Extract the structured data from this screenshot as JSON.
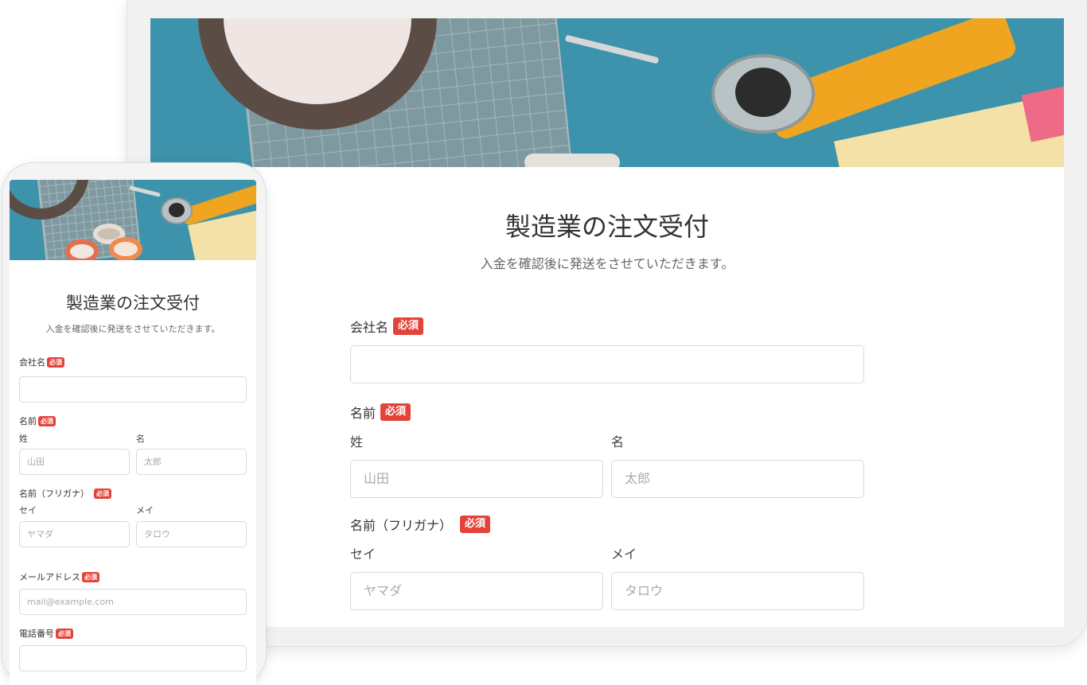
{
  "form": {
    "title": "製造業の注文受付",
    "subtitle": "入金を確認後に発送をさせていただきます。",
    "required_badge": "必須",
    "company": {
      "label": "会社名",
      "value": ""
    },
    "name": {
      "label": "名前",
      "last_label": "姓",
      "last_placeholder": "山田",
      "first_label": "名",
      "first_placeholder": "太郎"
    },
    "kana": {
      "label": "名前（フリガナ）",
      "last_label": "セイ",
      "last_placeholder": "ヤマダ",
      "first_label": "メイ",
      "first_placeholder": "タロウ"
    },
    "email": {
      "label": "メールアドレス",
      "placeholder": "mail@example.com"
    },
    "phone": {
      "label": "電話番号"
    }
  },
  "colors": {
    "required_badge": "#e4433a",
    "hero_background": "#3d93ab"
  },
  "icons": {
    "hero": "craft-tools-photo"
  }
}
